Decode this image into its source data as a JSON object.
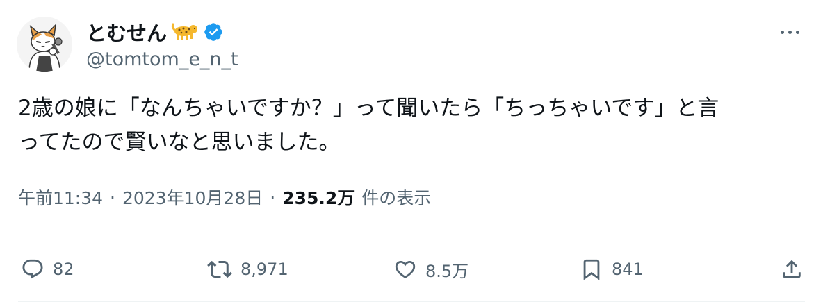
{
  "author": {
    "display_name": "とむせん",
    "handle": "@tomtom_e_n_t",
    "verified": true,
    "name_emoji": "leopard-emoji-icon"
  },
  "tweet": {
    "text": "2歳の娘に「なんちゃいですか？」って聞いたら「ちっちゃいです」と言\nってたので賢いなと思いました。"
  },
  "meta": {
    "time": "午前11:34",
    "separator": "·",
    "date": "2023年10月28日",
    "views_count": "235.2万",
    "views_label": "件の表示"
  },
  "actions": {
    "reply_count": "82",
    "retweet_count": "8,971",
    "like_count": "8.5万",
    "bookmark_count": "841"
  },
  "colors": {
    "text_primary": "#0f1419",
    "text_secondary": "#536471",
    "verified_blue": "#1d9bf0",
    "divider": "#eff3f4"
  }
}
